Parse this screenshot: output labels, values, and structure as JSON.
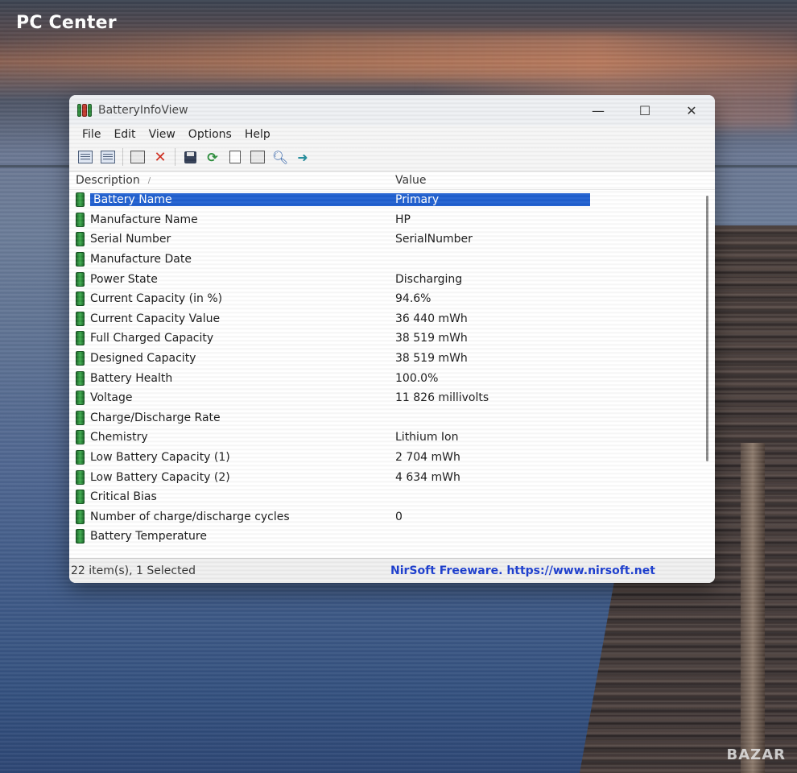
{
  "watermark": "PC Center",
  "corner_mark": "BAZAR",
  "window": {
    "title": "BatteryInfoView",
    "controls": {
      "minimize": "—",
      "maximize": "☐",
      "close": "✕"
    }
  },
  "menu": [
    "File",
    "Edit",
    "View",
    "Options",
    "Help"
  ],
  "toolbar": {
    "icons": [
      "html-report-icon",
      "report-icon",
      "window-icon",
      "delete-icon",
      "save-icon",
      "refresh-icon",
      "copy-icon",
      "properties-icon",
      "search-icon",
      "exit-icon"
    ]
  },
  "list": {
    "headers": {
      "description": "Description",
      "sort_indicator": "/",
      "value": "Value"
    },
    "rows": [
      {
        "description": "Battery Name",
        "value": "Primary",
        "selected": true
      },
      {
        "description": "Manufacture Name",
        "value": "HP"
      },
      {
        "description": "Serial Number",
        "value": "SerialNumber"
      },
      {
        "description": "Manufacture Date",
        "value": ""
      },
      {
        "description": "Power State",
        "value": "Discharging"
      },
      {
        "description": "Current Capacity (in %)",
        "value": "94.6%"
      },
      {
        "description": "Current Capacity Value",
        "value": "36 440 mWh"
      },
      {
        "description": "Full Charged Capacity",
        "value": "38 519 mWh"
      },
      {
        "description": "Designed Capacity",
        "value": "38 519 mWh"
      },
      {
        "description": "Battery Health",
        "value": "100.0%"
      },
      {
        "description": "Voltage",
        "value": "11 826 millivolts"
      },
      {
        "description": "Charge/Discharge Rate",
        "value": ""
      },
      {
        "description": "Chemistry",
        "value": "Lithium Ion"
      },
      {
        "description": "Low Battery Capacity (1)",
        "value": "2 704 mWh"
      },
      {
        "description": "Low Battery Capacity (2)",
        "value": "4 634 mWh"
      },
      {
        "description": "Critical Bias",
        "value": ""
      },
      {
        "description": "Number of charge/discharge cycles",
        "value": "0"
      },
      {
        "description": "Battery Temperature",
        "value": ""
      }
    ]
  },
  "status": {
    "items": "22 item(s), 1 Selected",
    "link": "NirSoft Freeware. https://www.nirsoft.net"
  },
  "colors": {
    "selection": "#1f5fd0",
    "link": "#1a3ccf",
    "battery_icon": "#3fae4e"
  }
}
